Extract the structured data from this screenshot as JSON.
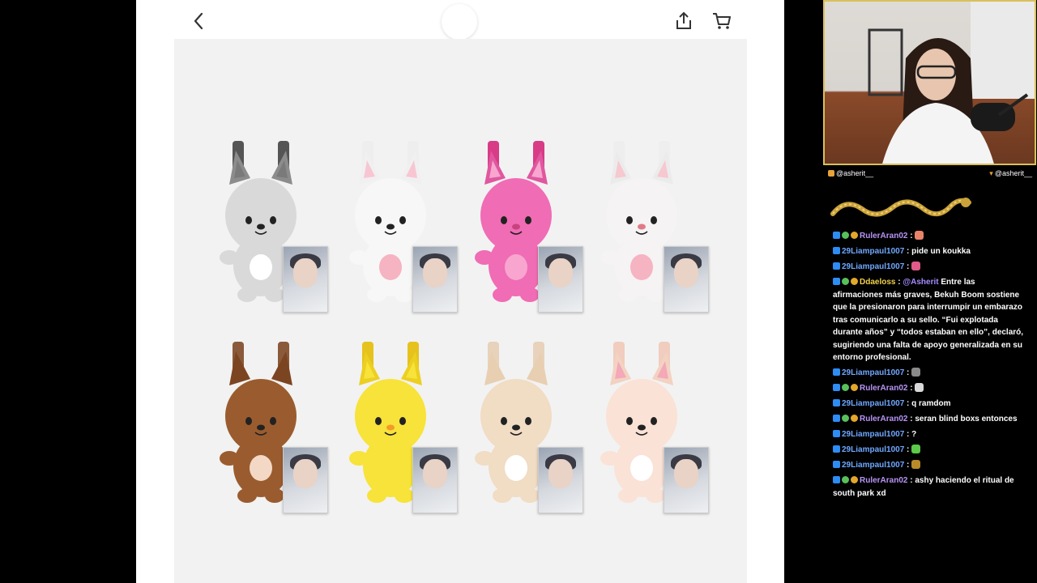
{
  "social": {
    "instagram": "@asherit__",
    "twitter": "@asherit__"
  },
  "chat": [
    {
      "user": "RulerAran02",
      "color": "#b794f6",
      "badges": [
        "blue",
        "green",
        "gold"
      ],
      "text": "",
      "emote": "#e8836a"
    },
    {
      "user": "29Liampaul1007",
      "color": "#6fa8ff",
      "badges": [
        "blue"
      ],
      "text": "pide un koukka",
      "emote": ""
    },
    {
      "user": "29Liampaul1007",
      "color": "#6fa8ff",
      "badges": [
        "blue"
      ],
      "text": "",
      "emote": "#e05a8a"
    },
    {
      "user": "Ddaeloss",
      "color": "#f2d14a",
      "badges": [
        "blue",
        "green",
        "gold"
      ],
      "mention": "@Asherit",
      "text": "Entre las afirmaciones más graves, Bekuh Boom sostiene que la presionaron para interrumpir un embarazo tras comunicarlo a su sello. “Fui explotada durante años” y “todos estaban en ello”, declaró, sugiriendo una falta de apoyo generalizada en su entorno profesional.",
      "emote": ""
    },
    {
      "user": "29Liampaul1007",
      "color": "#6fa8ff",
      "badges": [
        "blue"
      ],
      "text": "",
      "emote": "#8a8a8a"
    },
    {
      "user": "RulerAran02",
      "color": "#b794f6",
      "badges": [
        "blue",
        "green",
        "gold"
      ],
      "text": "",
      "emote": "#d9d9d9"
    },
    {
      "user": "29Liampaul1007",
      "color": "#6fa8ff",
      "badges": [
        "blue"
      ],
      "text": "q ramdom",
      "emote": ""
    },
    {
      "user": "RulerAran02",
      "color": "#b794f6",
      "badges": [
        "blue",
        "green",
        "gold"
      ],
      "text": "seran blind boxs entonces",
      "emote": ""
    },
    {
      "user": "29Liampaul1007",
      "color": "#6fa8ff",
      "badges": [
        "blue"
      ],
      "text": "?",
      "emote": ""
    },
    {
      "user": "29Liampaul1007",
      "color": "#6fa8ff",
      "badges": [
        "blue"
      ],
      "text": "",
      "emote": "#5cc94a"
    },
    {
      "user": "29Liampaul1007",
      "color": "#6fa8ff",
      "badges": [
        "blue"
      ],
      "text": "",
      "emote": "#b98a2a"
    },
    {
      "user": "RulerAran02",
      "color": "#b794f6",
      "badges": [
        "blue",
        "green",
        "gold"
      ],
      "text": "ashy haciendo el ritual de south park xd",
      "emote": ""
    }
  ],
  "products": [
    {
      "name": "wolf",
      "body": "#d9d9d9",
      "dark": "#8c8c8c",
      "ear": "#7a7a7a",
      "strap": "#555555",
      "belly": "#ffffff",
      "nose": "#222222"
    },
    {
      "name": "rabbit",
      "body": "#f7f7f7",
      "dark": "#f0f0f0",
      "ear": "#f8c6d2",
      "strap": "#eeeeee",
      "belly": "#f6b3c2",
      "nose": "#222222"
    },
    {
      "name": "pig-rabbit",
      "body": "#f06cb4",
      "dark": "#e0579f",
      "ear": "#f8a6cf",
      "strap": "#d83c86",
      "belly": "#f8a6cf",
      "nose": "#c8427f"
    },
    {
      "name": "cat",
      "body": "#f5f3f3",
      "dark": "#ecebeb",
      "ear": "#f6c8d0",
      "strap": "#eeeeee",
      "belly": "#f6b3c2",
      "nose": "#e07a86"
    },
    {
      "name": "puppy",
      "body": "#9a5c2e",
      "dark": "#7c4521",
      "ear": "#7c4521",
      "strap": "#8a5a3a",
      "belly": "#f3d8c6",
      "nose": "#222222"
    },
    {
      "name": "chick",
      "body": "#f7e33a",
      "dark": "#eccf20",
      "ear": "#f7e33a",
      "strap": "#e6c21e",
      "belly": "#f7e33a",
      "nose": "#f59a2a"
    },
    {
      "name": "bear",
      "body": "#f1dcc4",
      "dark": "#e8cfb2",
      "ear": "#e8cfb2",
      "strap": "#e8d2bb",
      "belly": "#ffffff",
      "nose": "#222222"
    },
    {
      "name": "fox",
      "body": "#fae2d6",
      "dark": "#f3d2c2",
      "ear": "#f4a8b8",
      "strap": "#f0cdbf",
      "belly": "#ffffff",
      "nose": "#222222"
    }
  ]
}
